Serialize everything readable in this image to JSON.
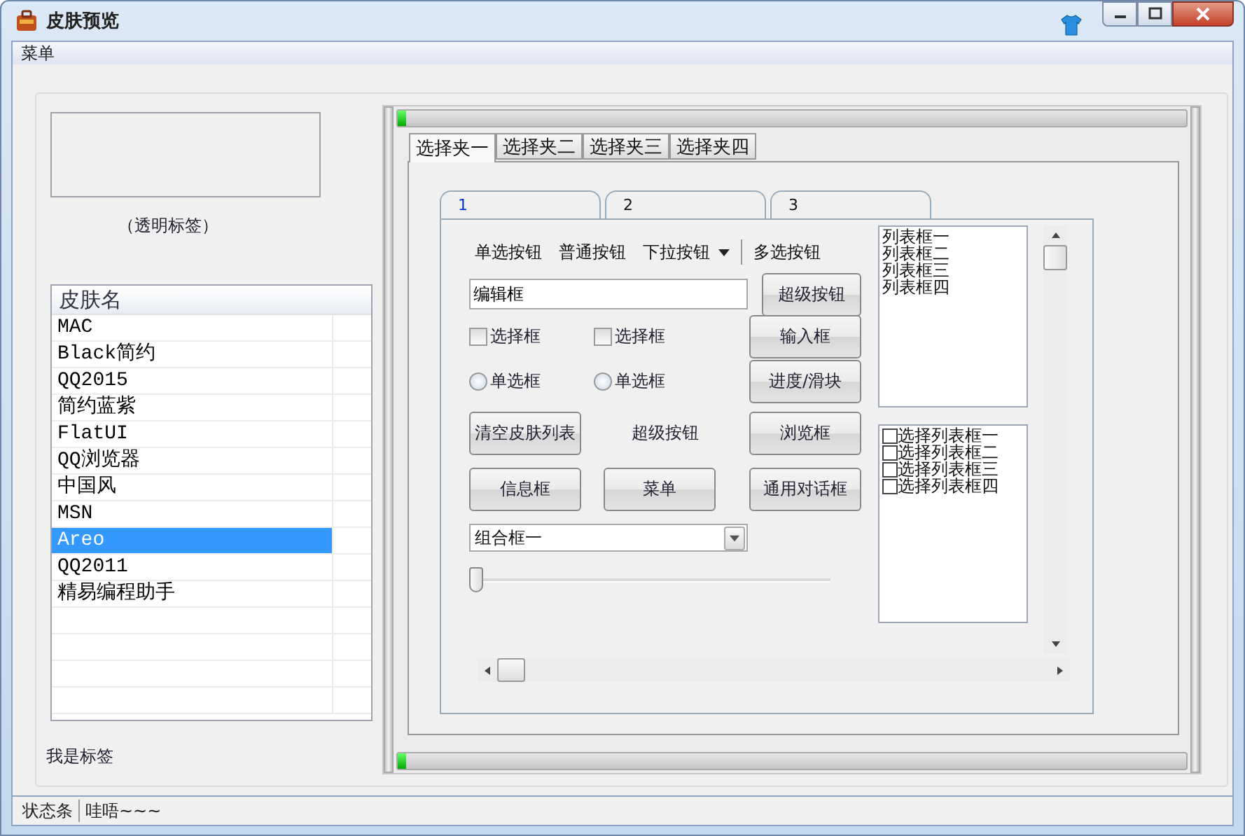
{
  "window": {
    "title": "皮肤预览"
  },
  "menu": [
    "菜单"
  ],
  "transparent_label": "（透明标签）",
  "skin_list": {
    "header": "皮肤名",
    "rows": [
      {
        "name": "MAC",
        "selected": false
      },
      {
        "name": "Black简约",
        "selected": false
      },
      {
        "name": "QQ2015",
        "selected": false
      },
      {
        "name": "简约蓝紫",
        "selected": false
      },
      {
        "name": "FlatUI",
        "selected": false
      },
      {
        "name": "QQ浏览器",
        "selected": false
      },
      {
        "name": "中国风",
        "selected": false
      },
      {
        "name": "MSN",
        "selected": false
      },
      {
        "name": "Areo",
        "selected": true
      },
      {
        "name": "QQ2011",
        "selected": false
      },
      {
        "name": "精易编程助手",
        "selected": false
      }
    ]
  },
  "bottom_label": "我是标签",
  "progress_bars": [
    {
      "level": 0.01
    },
    {
      "level": 0.01
    }
  ],
  "tabs": [
    {
      "label": "选择夹一",
      "selected": true
    },
    {
      "label": "选择夹二",
      "selected": false
    },
    {
      "label": "选择夹三",
      "selected": false
    },
    {
      "label": "选择夹四",
      "selected": false
    }
  ],
  "inner_tabs": [
    {
      "label": "1",
      "selected": true
    },
    {
      "label": "2",
      "selected": false
    },
    {
      "label": "3",
      "selected": false
    }
  ],
  "toolbar": [
    {
      "kind": "button",
      "label": "单选按钮"
    },
    {
      "kind": "button",
      "label": "普通按钮"
    },
    {
      "kind": "dropdown",
      "label": "下拉按钮"
    },
    {
      "kind": "separator"
    },
    {
      "kind": "button",
      "label": "多选按钮"
    }
  ],
  "form": {
    "edit": "编辑框",
    "super_button": "超级按钮",
    "checkboxes": [
      {
        "label": "选择框",
        "checked": false
      },
      {
        "label": "选择框",
        "checked": false
      }
    ],
    "radios": [
      {
        "label": "单选框",
        "selected": false
      },
      {
        "label": "单选框",
        "selected": false
      }
    ],
    "side_buttons": [
      "输入框",
      "进度/滑块",
      "浏览框",
      "通用对话框"
    ],
    "clear_button": "清空皮肤列表",
    "super_label": "超级按钮",
    "info_button": "信息框",
    "menu_button": "菜单",
    "combo": "组合框一",
    "slider": {
      "level": 0
    }
  },
  "list_box": [
    "列表框一",
    "列表框二",
    "列表框三",
    "列表框四"
  ],
  "check_list": [
    {
      "label": "选择列表框一",
      "checked": false
    },
    {
      "label": "选择列表框二",
      "checked": false
    },
    {
      "label": "选择列表框三",
      "checked": false
    },
    {
      "label": "选择列表框四",
      "checked": false
    }
  ],
  "status_bar": [
    "状态条",
    "哇唔~~~"
  ]
}
